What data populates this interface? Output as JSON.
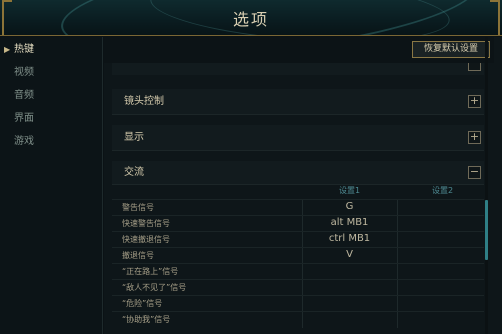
{
  "window": {
    "title": "选项"
  },
  "sidebar": {
    "items": [
      {
        "label": "热键",
        "active": true
      },
      {
        "label": "视频",
        "active": false
      },
      {
        "label": "音频",
        "active": false
      },
      {
        "label": "界面",
        "active": false
      },
      {
        "label": "游戏",
        "active": false
      }
    ]
  },
  "toolbar": {
    "reset_label": "恢复默认设置"
  },
  "sections": [
    {
      "title": "镜头控制",
      "toggle": "+"
    },
    {
      "title": "显示",
      "toggle": "+"
    },
    {
      "title": "交流",
      "toggle": "−"
    }
  ],
  "table": {
    "columns": [
      "设置1",
      "设置2"
    ],
    "rows": [
      {
        "label": "警告信号",
        "key1": "G",
        "key2": ""
      },
      {
        "label": "快速警告信号",
        "key1": "alt  MB1",
        "key2": ""
      },
      {
        "label": "快速撤退信号",
        "key1": "ctrl  MB1",
        "key2": ""
      },
      {
        "label": "撤退信号",
        "key1": "V",
        "key2": ""
      },
      {
        "label": "“正在路上”信号",
        "key1": "",
        "key2": ""
      },
      {
        "label": "“敌人不见了”信号",
        "key1": "",
        "key2": ""
      },
      {
        "label": "“危险”信号",
        "key1": "",
        "key2": ""
      },
      {
        "label": "“协助我”信号",
        "key1": "",
        "key2": ""
      }
    ]
  },
  "colors": {
    "accent_gold": "#8a7744",
    "column_header": "#4e8a92",
    "scrollbar": "#2f7f86"
  }
}
